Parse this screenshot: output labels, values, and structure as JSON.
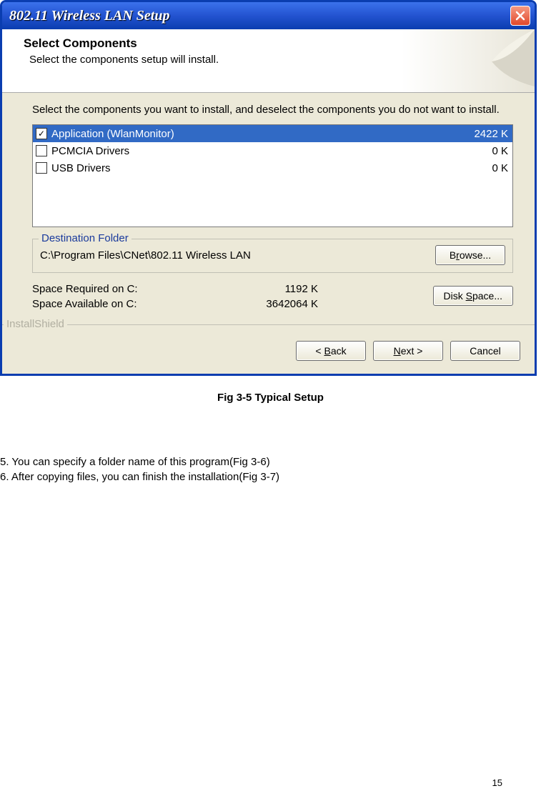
{
  "dialog": {
    "title": "802.11 Wireless LAN Setup",
    "header_title": "Select Components",
    "header_sub": "Select the components setup will install.",
    "instruction": "Select the components you want to install, and deselect the components you do not want to install.",
    "components": [
      {
        "name": "Application (WlanMonitor)",
        "size": "2422 K",
        "checked": true,
        "selected": true
      },
      {
        "name": "PCMCIA Drivers",
        "size": "0 K",
        "checked": false,
        "selected": false
      },
      {
        "name": "USB Drivers",
        "size": "0 K",
        "checked": false,
        "selected": false
      }
    ],
    "destination_legend": "Destination Folder",
    "destination_path": "C:\\Program Files\\CNet\\802.11 Wireless LAN",
    "browse_label": "Browse...",
    "space_required_label": "Space Required on C:",
    "space_required_value": "1192 K",
    "space_available_label": "Space Available on C:",
    "space_available_value": "3642064 K",
    "disk_space_label": "Disk Space...",
    "footer_brand": "InstallShield",
    "back_label": "< Back",
    "next_label": "Next >",
    "cancel_label": "Cancel"
  },
  "caption": "Fig 3-5 Typical Setup",
  "doc_line5": "5. You can specify a folder name of this program(Fig 3-6)",
  "doc_line6": "6. After copying files, you can finish the installation(Fig 3-7)",
  "page_number": "15"
}
